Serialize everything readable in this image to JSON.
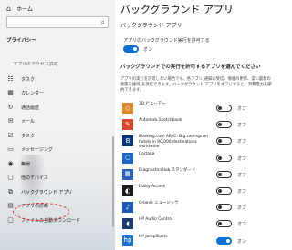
{
  "sidebar": {
    "home_icon": "home-icon",
    "home_label": "ホーム",
    "search_icon": "search-icon",
    "heading": "プライバシー",
    "section_label": "アプリのアクセス許可",
    "items": [
      {
        "name": "sidebar-item-tasks",
        "icon": "☷",
        "label": "タスク"
      },
      {
        "name": "sidebar-item-calendar",
        "icon": "▦",
        "label": "カレンダー"
      },
      {
        "name": "sidebar-item-call-history",
        "icon": "↻",
        "label": "通話履歴"
      },
      {
        "name": "sidebar-item-email",
        "icon": "✉",
        "label": "メール"
      },
      {
        "name": "sidebar-item-tasks-2",
        "icon": "☑",
        "label": "タスク"
      },
      {
        "name": "sidebar-item-messaging",
        "icon": "▭",
        "label": "メッセージング"
      },
      {
        "name": "sidebar-item-radio",
        "icon": "◉",
        "label": "無線"
      },
      {
        "name": "sidebar-item-other-devices",
        "icon": "▢",
        "label": "他のデバイス"
      },
      {
        "name": "sidebar-item-background-apps",
        "icon": "⧉",
        "label": "バックグラウンド アプリ"
      },
      {
        "name": "sidebar-item-app-diagnostics",
        "icon": "▤",
        "label": "アプリの診断"
      },
      {
        "name": "sidebar-item-auto-file-downloads",
        "icon": "▢",
        "label": "ファイルの自動ダウンロード"
      }
    ]
  },
  "main": {
    "title": "バックグラウンド アプリ",
    "section1_title": "バックグラウンド アプリ",
    "allow_label": "アプリのバックグラウンド実行を許可する",
    "allow_state": "オン",
    "section2_title": "バックグラウンドでの実行を許可するアプリを選んでください",
    "description": "アプリの実行を許可しない場合でも、各アプリ(通知の受信、情報の更新、常に最新の状態を維持)を受信できます。バックグラウンド アプリをオフにすると、消費電力を節約できます。",
    "apps": [
      {
        "name": "3D ビューアー",
        "icon": "cube-icon",
        "glyph": "◇",
        "color": "#e08a2b",
        "state": "オフ",
        "on": false
      },
      {
        "name": "Autodesk Sketchbook",
        "icon": "sketchbook-icon",
        "glyph": "✎",
        "color": "#d94a2c",
        "state": "オフ",
        "on": false
      },
      {
        "name": "Booking.com APAC: Big savings on hotels in 90,000 destinations worldwide",
        "icon": "booking-icon",
        "glyph": "B",
        "color": "#003580",
        "state": "オフ",
        "on": false
      },
      {
        "name": "Cortana",
        "icon": "cortana-icon",
        "glyph": "○",
        "color": "#1e66c8",
        "state": "オフ",
        "on": false
      },
      {
        "name": "DiagnosticsHub スタンダード",
        "icon": "diagnostics-icon",
        "glyph": "▦",
        "color": "#2a62b8",
        "state": "オフ",
        "on": false
      },
      {
        "name": "Dolby Access",
        "icon": "dolby-icon",
        "glyph": "◐",
        "color": "#1a1a1a",
        "state": "オフ",
        "on": false
      },
      {
        "name": "Groove ミュージック",
        "icon": "groove-music-icon",
        "glyph": "♪",
        "color": "#1f5bb5",
        "state": "オフ",
        "on": false
      },
      {
        "name": "HP Audio Control",
        "icon": "hp-audio-icon",
        "glyph": "◖",
        "color": "#1d3c6e",
        "state": "オフ",
        "on": false
      },
      {
        "name": "HP JumpStarts",
        "icon": "hp-jumpstarts-icon",
        "glyph": "hp",
        "color": "#1a73c9",
        "state": "オン",
        "on": true
      }
    ]
  }
}
